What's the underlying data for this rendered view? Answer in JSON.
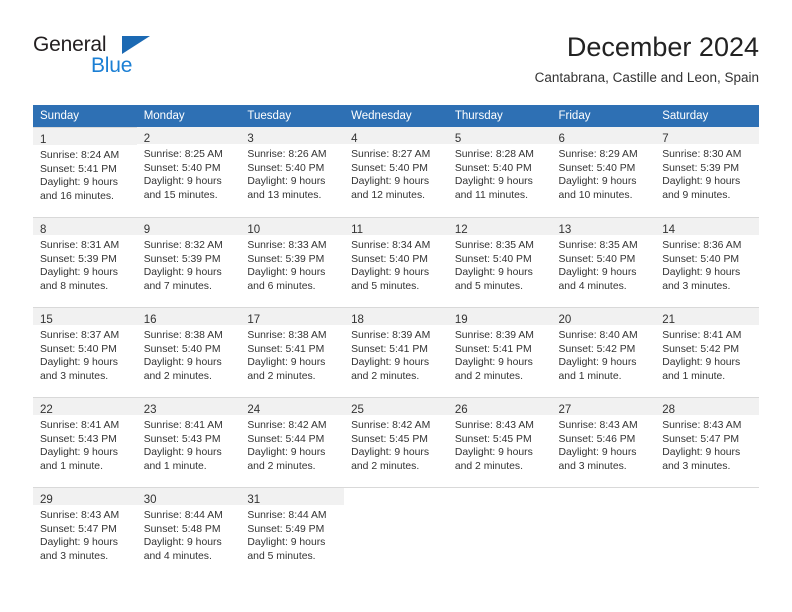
{
  "brand": {
    "word_one": "General",
    "word_two": "Blue",
    "flag_icon": "triangle-flag-icon",
    "accent_dark": "#1b69b3",
    "accent_light": "#1b7fd4"
  },
  "header": {
    "title": "December 2024",
    "subtitle": "Cantabrana, Castille and Leon, Spain"
  },
  "theme": {
    "header_blue": "#2e70b4",
    "daynum_band": "#f1f1f1",
    "grid_line": "#d9d9d9",
    "text": "#333333"
  },
  "calendar": {
    "weekday_headers": [
      "Sunday",
      "Monday",
      "Tuesday",
      "Wednesday",
      "Thursday",
      "Friday",
      "Saturday"
    ],
    "weeks": [
      [
        {
          "day": "1",
          "sunrise": "Sunrise: 8:24 AM",
          "sunset": "Sunset: 5:41 PM",
          "daylight": "Daylight: 9 hours and 16 minutes."
        },
        {
          "day": "2",
          "sunrise": "Sunrise: 8:25 AM",
          "sunset": "Sunset: 5:40 PM",
          "daylight": "Daylight: 9 hours and 15 minutes."
        },
        {
          "day": "3",
          "sunrise": "Sunrise: 8:26 AM",
          "sunset": "Sunset: 5:40 PM",
          "daylight": "Daylight: 9 hours and 13 minutes."
        },
        {
          "day": "4",
          "sunrise": "Sunrise: 8:27 AM",
          "sunset": "Sunset: 5:40 PM",
          "daylight": "Daylight: 9 hours and 12 minutes."
        },
        {
          "day": "5",
          "sunrise": "Sunrise: 8:28 AM",
          "sunset": "Sunset: 5:40 PM",
          "daylight": "Daylight: 9 hours and 11 minutes."
        },
        {
          "day": "6",
          "sunrise": "Sunrise: 8:29 AM",
          "sunset": "Sunset: 5:40 PM",
          "daylight": "Daylight: 9 hours and 10 minutes."
        },
        {
          "day": "7",
          "sunrise": "Sunrise: 8:30 AM",
          "sunset": "Sunset: 5:39 PM",
          "daylight": "Daylight: 9 hours and 9 minutes."
        }
      ],
      [
        {
          "day": "8",
          "sunrise": "Sunrise: 8:31 AM",
          "sunset": "Sunset: 5:39 PM",
          "daylight": "Daylight: 9 hours and 8 minutes."
        },
        {
          "day": "9",
          "sunrise": "Sunrise: 8:32 AM",
          "sunset": "Sunset: 5:39 PM",
          "daylight": "Daylight: 9 hours and 7 minutes."
        },
        {
          "day": "10",
          "sunrise": "Sunrise: 8:33 AM",
          "sunset": "Sunset: 5:39 PM",
          "daylight": "Daylight: 9 hours and 6 minutes."
        },
        {
          "day": "11",
          "sunrise": "Sunrise: 8:34 AM",
          "sunset": "Sunset: 5:40 PM",
          "daylight": "Daylight: 9 hours and 5 minutes."
        },
        {
          "day": "12",
          "sunrise": "Sunrise: 8:35 AM",
          "sunset": "Sunset: 5:40 PM",
          "daylight": "Daylight: 9 hours and 5 minutes."
        },
        {
          "day": "13",
          "sunrise": "Sunrise: 8:35 AM",
          "sunset": "Sunset: 5:40 PM",
          "daylight": "Daylight: 9 hours and 4 minutes."
        },
        {
          "day": "14",
          "sunrise": "Sunrise: 8:36 AM",
          "sunset": "Sunset: 5:40 PM",
          "daylight": "Daylight: 9 hours and 3 minutes."
        }
      ],
      [
        {
          "day": "15",
          "sunrise": "Sunrise: 8:37 AM",
          "sunset": "Sunset: 5:40 PM",
          "daylight": "Daylight: 9 hours and 3 minutes."
        },
        {
          "day": "16",
          "sunrise": "Sunrise: 8:38 AM",
          "sunset": "Sunset: 5:40 PM",
          "daylight": "Daylight: 9 hours and 2 minutes."
        },
        {
          "day": "17",
          "sunrise": "Sunrise: 8:38 AM",
          "sunset": "Sunset: 5:41 PM",
          "daylight": "Daylight: 9 hours and 2 minutes."
        },
        {
          "day": "18",
          "sunrise": "Sunrise: 8:39 AM",
          "sunset": "Sunset: 5:41 PM",
          "daylight": "Daylight: 9 hours and 2 minutes."
        },
        {
          "day": "19",
          "sunrise": "Sunrise: 8:39 AM",
          "sunset": "Sunset: 5:41 PM",
          "daylight": "Daylight: 9 hours and 2 minutes."
        },
        {
          "day": "20",
          "sunrise": "Sunrise: 8:40 AM",
          "sunset": "Sunset: 5:42 PM",
          "daylight": "Daylight: 9 hours and 1 minute."
        },
        {
          "day": "21",
          "sunrise": "Sunrise: 8:41 AM",
          "sunset": "Sunset: 5:42 PM",
          "daylight": "Daylight: 9 hours and 1 minute."
        }
      ],
      [
        {
          "day": "22",
          "sunrise": "Sunrise: 8:41 AM",
          "sunset": "Sunset: 5:43 PM",
          "daylight": "Daylight: 9 hours and 1 minute."
        },
        {
          "day": "23",
          "sunrise": "Sunrise: 8:41 AM",
          "sunset": "Sunset: 5:43 PM",
          "daylight": "Daylight: 9 hours and 1 minute."
        },
        {
          "day": "24",
          "sunrise": "Sunrise: 8:42 AM",
          "sunset": "Sunset: 5:44 PM",
          "daylight": "Daylight: 9 hours and 2 minutes."
        },
        {
          "day": "25",
          "sunrise": "Sunrise: 8:42 AM",
          "sunset": "Sunset: 5:45 PM",
          "daylight": "Daylight: 9 hours and 2 minutes."
        },
        {
          "day": "26",
          "sunrise": "Sunrise: 8:43 AM",
          "sunset": "Sunset: 5:45 PM",
          "daylight": "Daylight: 9 hours and 2 minutes."
        },
        {
          "day": "27",
          "sunrise": "Sunrise: 8:43 AM",
          "sunset": "Sunset: 5:46 PM",
          "daylight": "Daylight: 9 hours and 3 minutes."
        },
        {
          "day": "28",
          "sunrise": "Sunrise: 8:43 AM",
          "sunset": "Sunset: 5:47 PM",
          "daylight": "Daylight: 9 hours and 3 minutes."
        }
      ],
      [
        {
          "day": "29",
          "sunrise": "Sunrise: 8:43 AM",
          "sunset": "Sunset: 5:47 PM",
          "daylight": "Daylight: 9 hours and 3 minutes."
        },
        {
          "day": "30",
          "sunrise": "Sunrise: 8:44 AM",
          "sunset": "Sunset: 5:48 PM",
          "daylight": "Daylight: 9 hours and 4 minutes."
        },
        {
          "day": "31",
          "sunrise": "Sunrise: 8:44 AM",
          "sunset": "Sunset: 5:49 PM",
          "daylight": "Daylight: 9 hours and 5 minutes."
        },
        {
          "day": "",
          "sunrise": "",
          "sunset": "",
          "daylight": ""
        },
        {
          "day": "",
          "sunrise": "",
          "sunset": "",
          "daylight": ""
        },
        {
          "day": "",
          "sunrise": "",
          "sunset": "",
          "daylight": ""
        },
        {
          "day": "",
          "sunrise": "",
          "sunset": "",
          "daylight": ""
        }
      ]
    ]
  }
}
